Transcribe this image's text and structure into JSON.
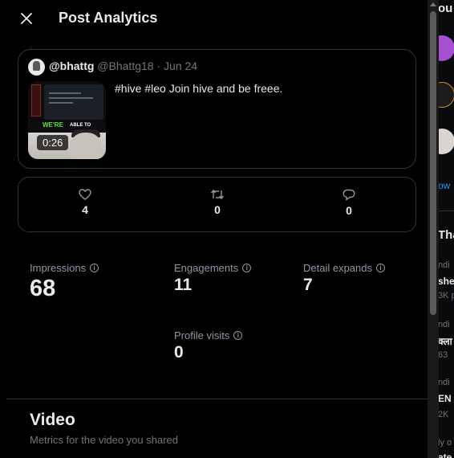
{
  "modal": {
    "title": "Post Analytics",
    "close_icon": "close-icon"
  },
  "post": {
    "display_name": "@bhattg",
    "handle": "@Bhattg18",
    "separator": "·",
    "date": "Jun 24",
    "text": "#hive #leo Join hive and be freee.",
    "video_duration": "0:26",
    "thumbnail_caption_green": "WE'RE",
    "thumbnail_caption_white": "ABLE TO"
  },
  "engagement": {
    "likes": {
      "icon": "heart-icon",
      "value": "4"
    },
    "reposts": {
      "icon": "repost-icon",
      "value": "0"
    },
    "replies": {
      "icon": "reply-icon",
      "value": "0"
    }
  },
  "metrics": [
    {
      "label": "Impressions",
      "value": "68"
    },
    {
      "label": "Engagements",
      "value": "11"
    },
    {
      "label": "Detail expands",
      "value": "7"
    },
    {
      "label": "Profile visits",
      "value": "0"
    }
  ],
  "video_section": {
    "title": "Video",
    "subtitle": "Metrics for the video you shared"
  },
  "right_panel": {
    "top_text": "ou",
    "link_text": "ow",
    "heading": "Tha",
    "trending_1": "ndi",
    "trend_1_name": "she",
    "trend_1_count": "3K p",
    "trending_2": "ndi",
    "trend_2_name": "क्ला",
    "trend_2_count": "63",
    "trending_3": "ndi",
    "trend_3_name": "EN",
    "trend_3_count": "2K",
    "trending_4": "ly o",
    "trend_4_name": "ate"
  },
  "colors": {
    "background": "#000000",
    "border": "#2f3336",
    "text_primary": "#e7e9ea",
    "text_secondary": "#71767b",
    "accent_blue": "#1d9bf0"
  }
}
